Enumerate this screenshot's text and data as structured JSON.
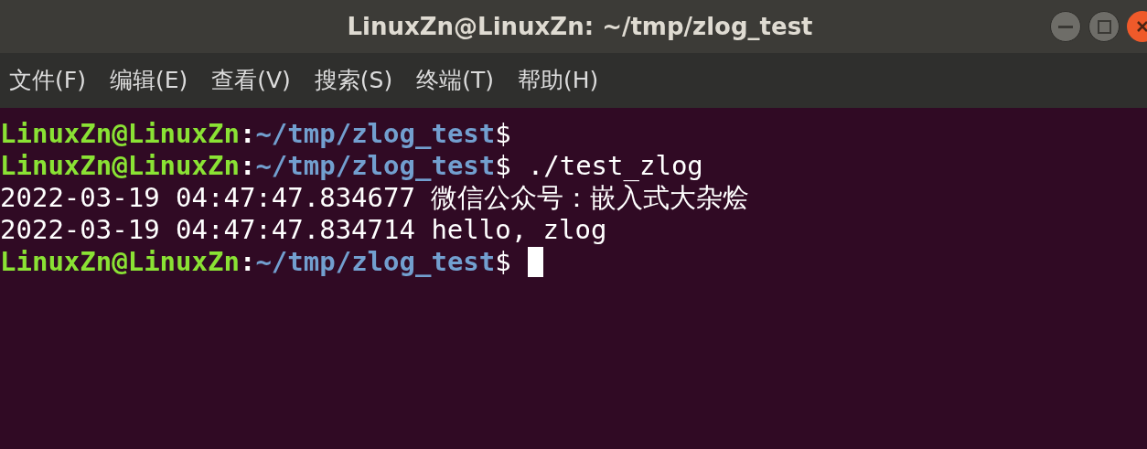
{
  "window": {
    "title": "LinuxZn@LinuxZn: ~/tmp/zlog_test"
  },
  "menu": [
    "文件(F)",
    "编辑(E)",
    "查看(V)",
    "搜索(S)",
    "终端(T)",
    "帮助(H)"
  ],
  "terminal": {
    "lines": [
      {
        "kind": "prompt",
        "user_host": "LinuxZn@LinuxZn",
        "separator": ":",
        "path": "~/tmp/zlog_test",
        "sign": "$",
        "cursor": false
      },
      {
        "kind": "prompt",
        "user_host": "LinuxZn@LinuxZn",
        "separator": ":",
        "path": "~/tmp/zlog_test",
        "sign": "$",
        "command": "./test_zlog",
        "cursor": false
      },
      {
        "kind": "output",
        "text": "2022-03-19 04:47:47.834677 微信公众号：嵌入式大杂烩"
      },
      {
        "kind": "output",
        "text": "2022-03-19 04:47:47.834714 hello, zlog"
      },
      {
        "kind": "prompt",
        "user_host": "LinuxZn@LinuxZn",
        "separator": ":",
        "path": "~/tmp/zlog_test",
        "sign": "$",
        "cursor": true
      }
    ]
  }
}
